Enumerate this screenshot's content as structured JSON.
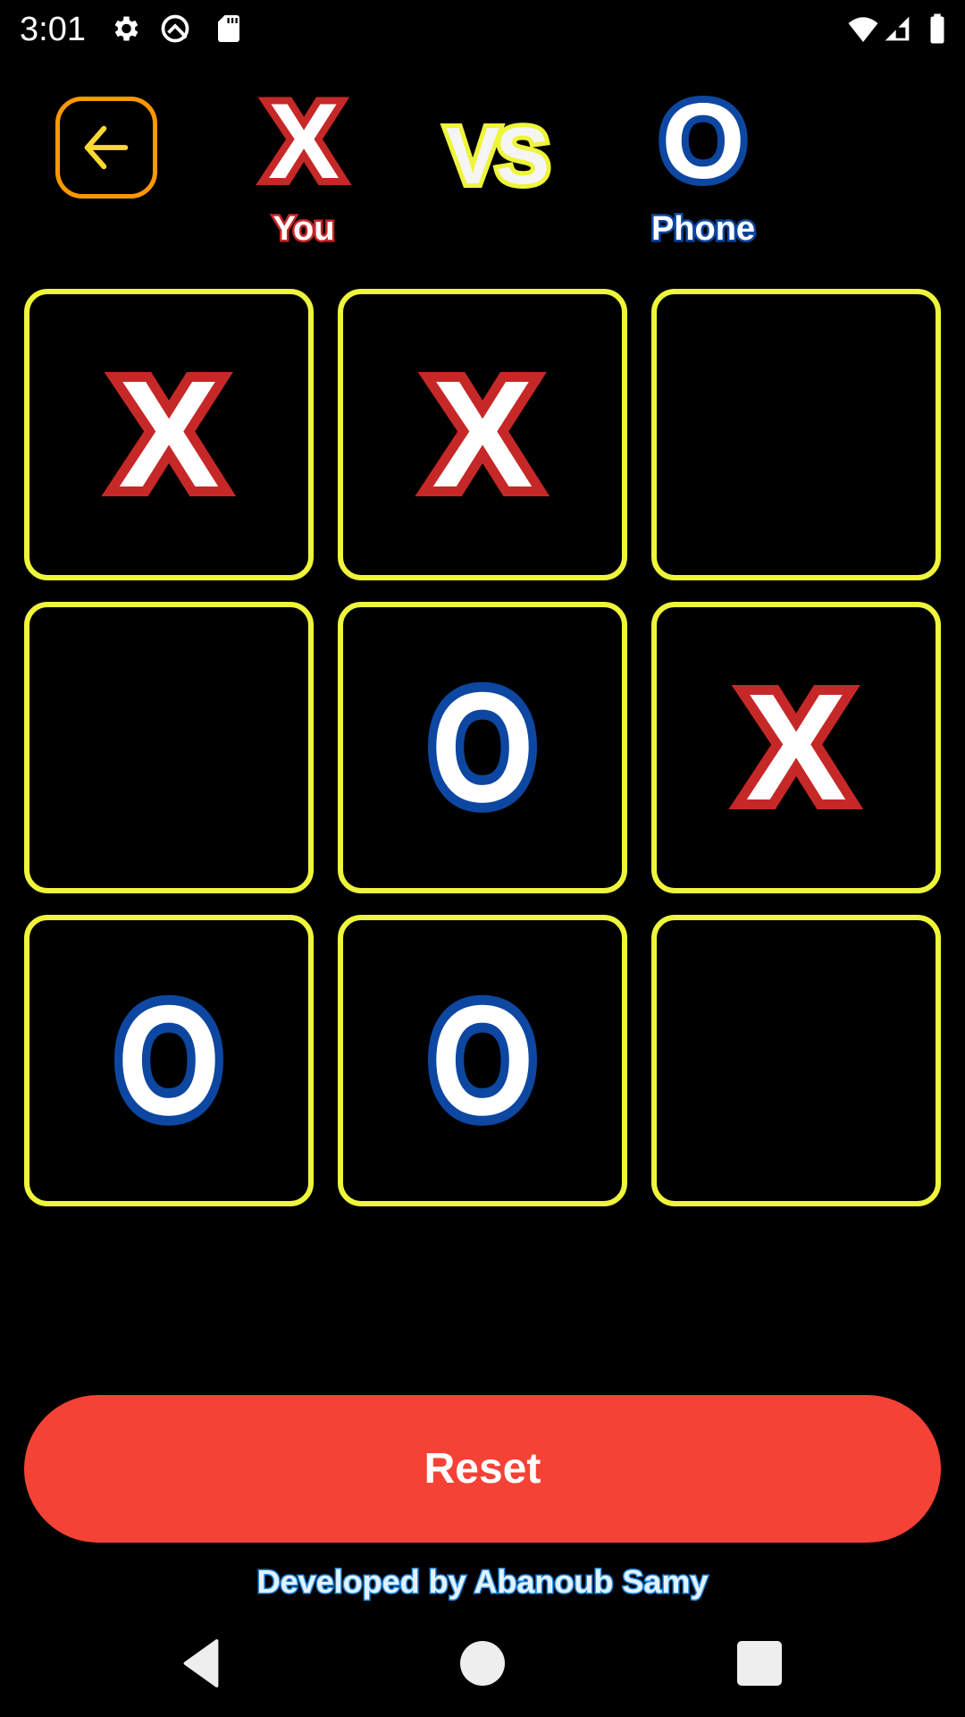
{
  "status_bar": {
    "time": "3:01",
    "left_icons": [
      "gear-icon",
      "q-icon",
      "sd-card-icon"
    ],
    "right_icons": [
      "wifi-icon",
      "signal-icon",
      "battery-icon"
    ]
  },
  "header": {
    "back_icon": "arrow-left-icon",
    "player_mark": "X",
    "player_label": "You",
    "vs_label": "VS",
    "opponent_mark": "O",
    "opponent_label": "Phone"
  },
  "board": {
    "cells": [
      [
        "X",
        "X",
        ""
      ],
      [
        "",
        "O",
        "X"
      ],
      [
        "O",
        "O",
        ""
      ]
    ]
  },
  "reset_label": "Reset",
  "footer_text": "Developed by Abanoub Samy",
  "navbar": {
    "buttons": [
      "back-nav-icon",
      "home-nav-icon",
      "recents-nav-icon"
    ]
  },
  "colors": {
    "x_outline": "#c62828",
    "o_outline": "#0d47a1",
    "cell_border": "#eef53a",
    "back_border": "#ff9800",
    "reset_bg": "#f44336"
  }
}
